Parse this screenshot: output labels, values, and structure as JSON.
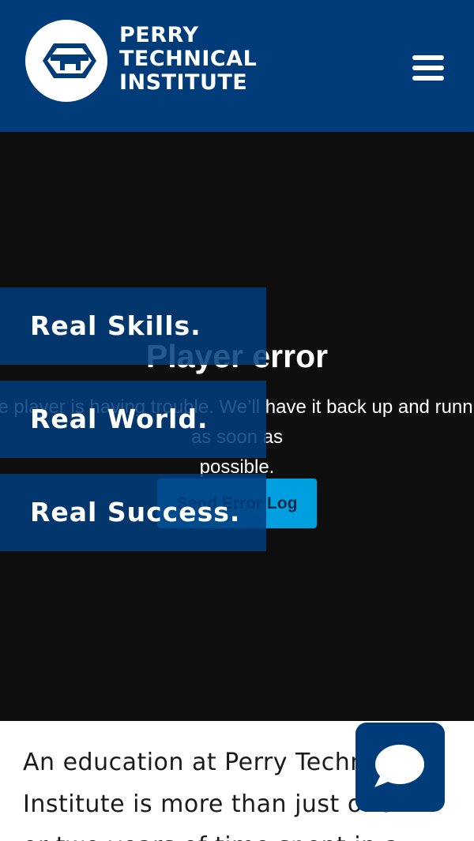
{
  "header": {
    "logo_lines": [
      "PERRY",
      "TECHNICAL",
      "INSTITUTE"
    ],
    "menu_icon": "hamburger-menu-icon"
  },
  "hero": {
    "player_error": {
      "title": "Player error",
      "message_line1": "The player is having trouble. We’ll have it back up and running as soon as",
      "message_line2": "possible.",
      "button_label": "Send Error Log"
    },
    "taglines": [
      "Real Skills.",
      "Real World.",
      "Real Success."
    ]
  },
  "intro": {
    "lines": [
      "An education at Perry Technical",
      "Institute is more than just one",
      "or two years of time spent in a"
    ]
  },
  "chat": {
    "icon": "chat-bubble-icon"
  },
  "colors": {
    "brand_blue": "#003b7a",
    "accent_cyan": "#00a0e0",
    "hero_bg": "#0e0e0e"
  }
}
